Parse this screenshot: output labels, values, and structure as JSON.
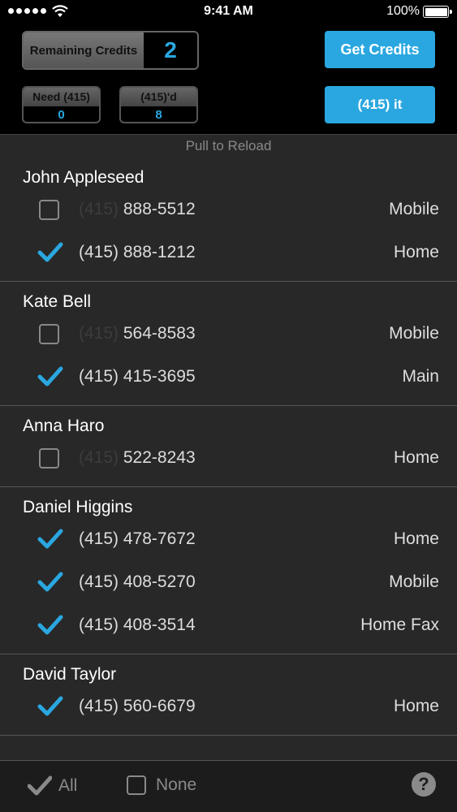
{
  "status": {
    "time": "9:41 AM",
    "battery": "100%"
  },
  "header": {
    "remaining_label": "Remaining Credits",
    "remaining_value": "2",
    "get_credits": "Get Credits",
    "need_label": "Need (415)",
    "need_value": "0",
    "done_label": "(415)'d",
    "done_value": "8",
    "action": "(415) it"
  },
  "list": {
    "pull_text": "Pull to Reload",
    "contacts": [
      {
        "name": "John Appleseed",
        "phones": [
          {
            "area": "(415)",
            "number": "888-5512",
            "type": "Mobile",
            "checked": false
          },
          {
            "area": "(415)",
            "number": "888-1212",
            "type": "Home",
            "checked": true
          }
        ]
      },
      {
        "name": "Kate Bell",
        "phones": [
          {
            "area": "(415)",
            "number": "564-8583",
            "type": "Mobile",
            "checked": false
          },
          {
            "area": "(415)",
            "number": "415-3695",
            "type": "Main",
            "checked": true
          }
        ]
      },
      {
        "name": "Anna Haro",
        "phones": [
          {
            "area": "(415)",
            "number": "522-8243",
            "type": "Home",
            "checked": false
          }
        ]
      },
      {
        "name": "Daniel Higgins",
        "phones": [
          {
            "area": "(415)",
            "number": "478-7672",
            "type": "Home",
            "checked": true
          },
          {
            "area": "(415)",
            "number": "408-5270",
            "type": "Mobile",
            "checked": true
          },
          {
            "area": "(415)",
            "number": "408-3514",
            "type": "Home Fax",
            "checked": true
          }
        ]
      },
      {
        "name": "David Taylor",
        "phones": [
          {
            "area": "(415)",
            "number": "560-6679",
            "type": "Home",
            "checked": true
          }
        ]
      }
    ]
  },
  "bottom": {
    "all_label": "All",
    "none_label": "None",
    "help_icon": "?"
  },
  "colors": {
    "accent": "#2aa7e0",
    "list_bg": "#282828",
    "dim_area": "#3c3c3c"
  }
}
